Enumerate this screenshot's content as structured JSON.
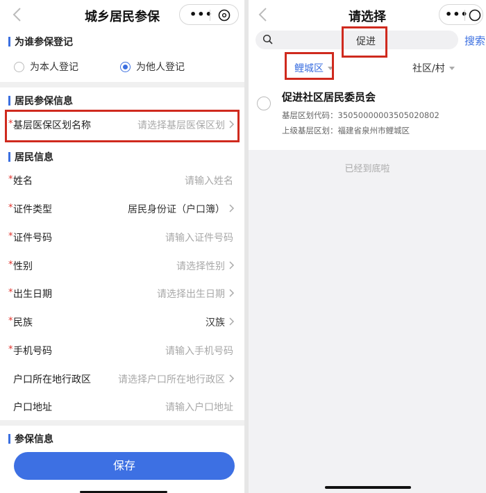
{
  "left": {
    "title": "城乡居民参保",
    "registration": {
      "section_title": "为谁参保登记",
      "option_self": "为本人登记",
      "option_other": "为他人登记",
      "selected": "option_other"
    },
    "insurance_info": {
      "section_title": "居民参保信息",
      "division_label": "基层医保区划名称",
      "division_placeholder": "请选择基层医保区划"
    },
    "resident_info": {
      "section_title": "居民信息",
      "fields": [
        {
          "label": "姓名",
          "value": "请输入姓名",
          "required": "*"
        },
        {
          "label": "证件类型",
          "value": "居民身份证（户口簿）",
          "required": "*"
        },
        {
          "label": "证件号码",
          "value": "请输入证件号码",
          "required": "*"
        },
        {
          "label": "性别",
          "value": "请选择性别",
          "required": "*"
        },
        {
          "label": "出生日期",
          "value": "请选择出生日期",
          "required": "*"
        },
        {
          "label": "民族",
          "value": "汉族",
          "required": "*"
        },
        {
          "label": "手机号码",
          "value": "请输入手机号码",
          "required": "*"
        },
        {
          "label": "户口所在地行政区",
          "value": "请选择户口所在地行政区",
          "required": ""
        },
        {
          "label": "户口地址",
          "value": "请输入户口地址",
          "required": ""
        }
      ]
    },
    "participation_info": {
      "section_title": "参保信息"
    },
    "save_label": "保存"
  },
  "right": {
    "title": "请选择",
    "search": {
      "value": "促进",
      "button": "搜索"
    },
    "filters": {
      "district": "鲤城区",
      "community": "社区/村"
    },
    "result": {
      "name": "促进社区居民委员会",
      "code_label": "基层区划代码：",
      "code": "35050000003505020802",
      "parent_label": "上级基层区划：",
      "parent": "福建省泉州市鲤城区"
    },
    "end_text": "已经到底啦"
  },
  "colors": {
    "accent": "#3d70e3",
    "highlight_box": "#cf2a1e",
    "required": "#e0302a"
  },
  "icons": [
    "back-icon",
    "more-dots-icon",
    "close-circle-icon",
    "chevron-right-icon",
    "search-icon",
    "dropdown-triangle-icon"
  ]
}
